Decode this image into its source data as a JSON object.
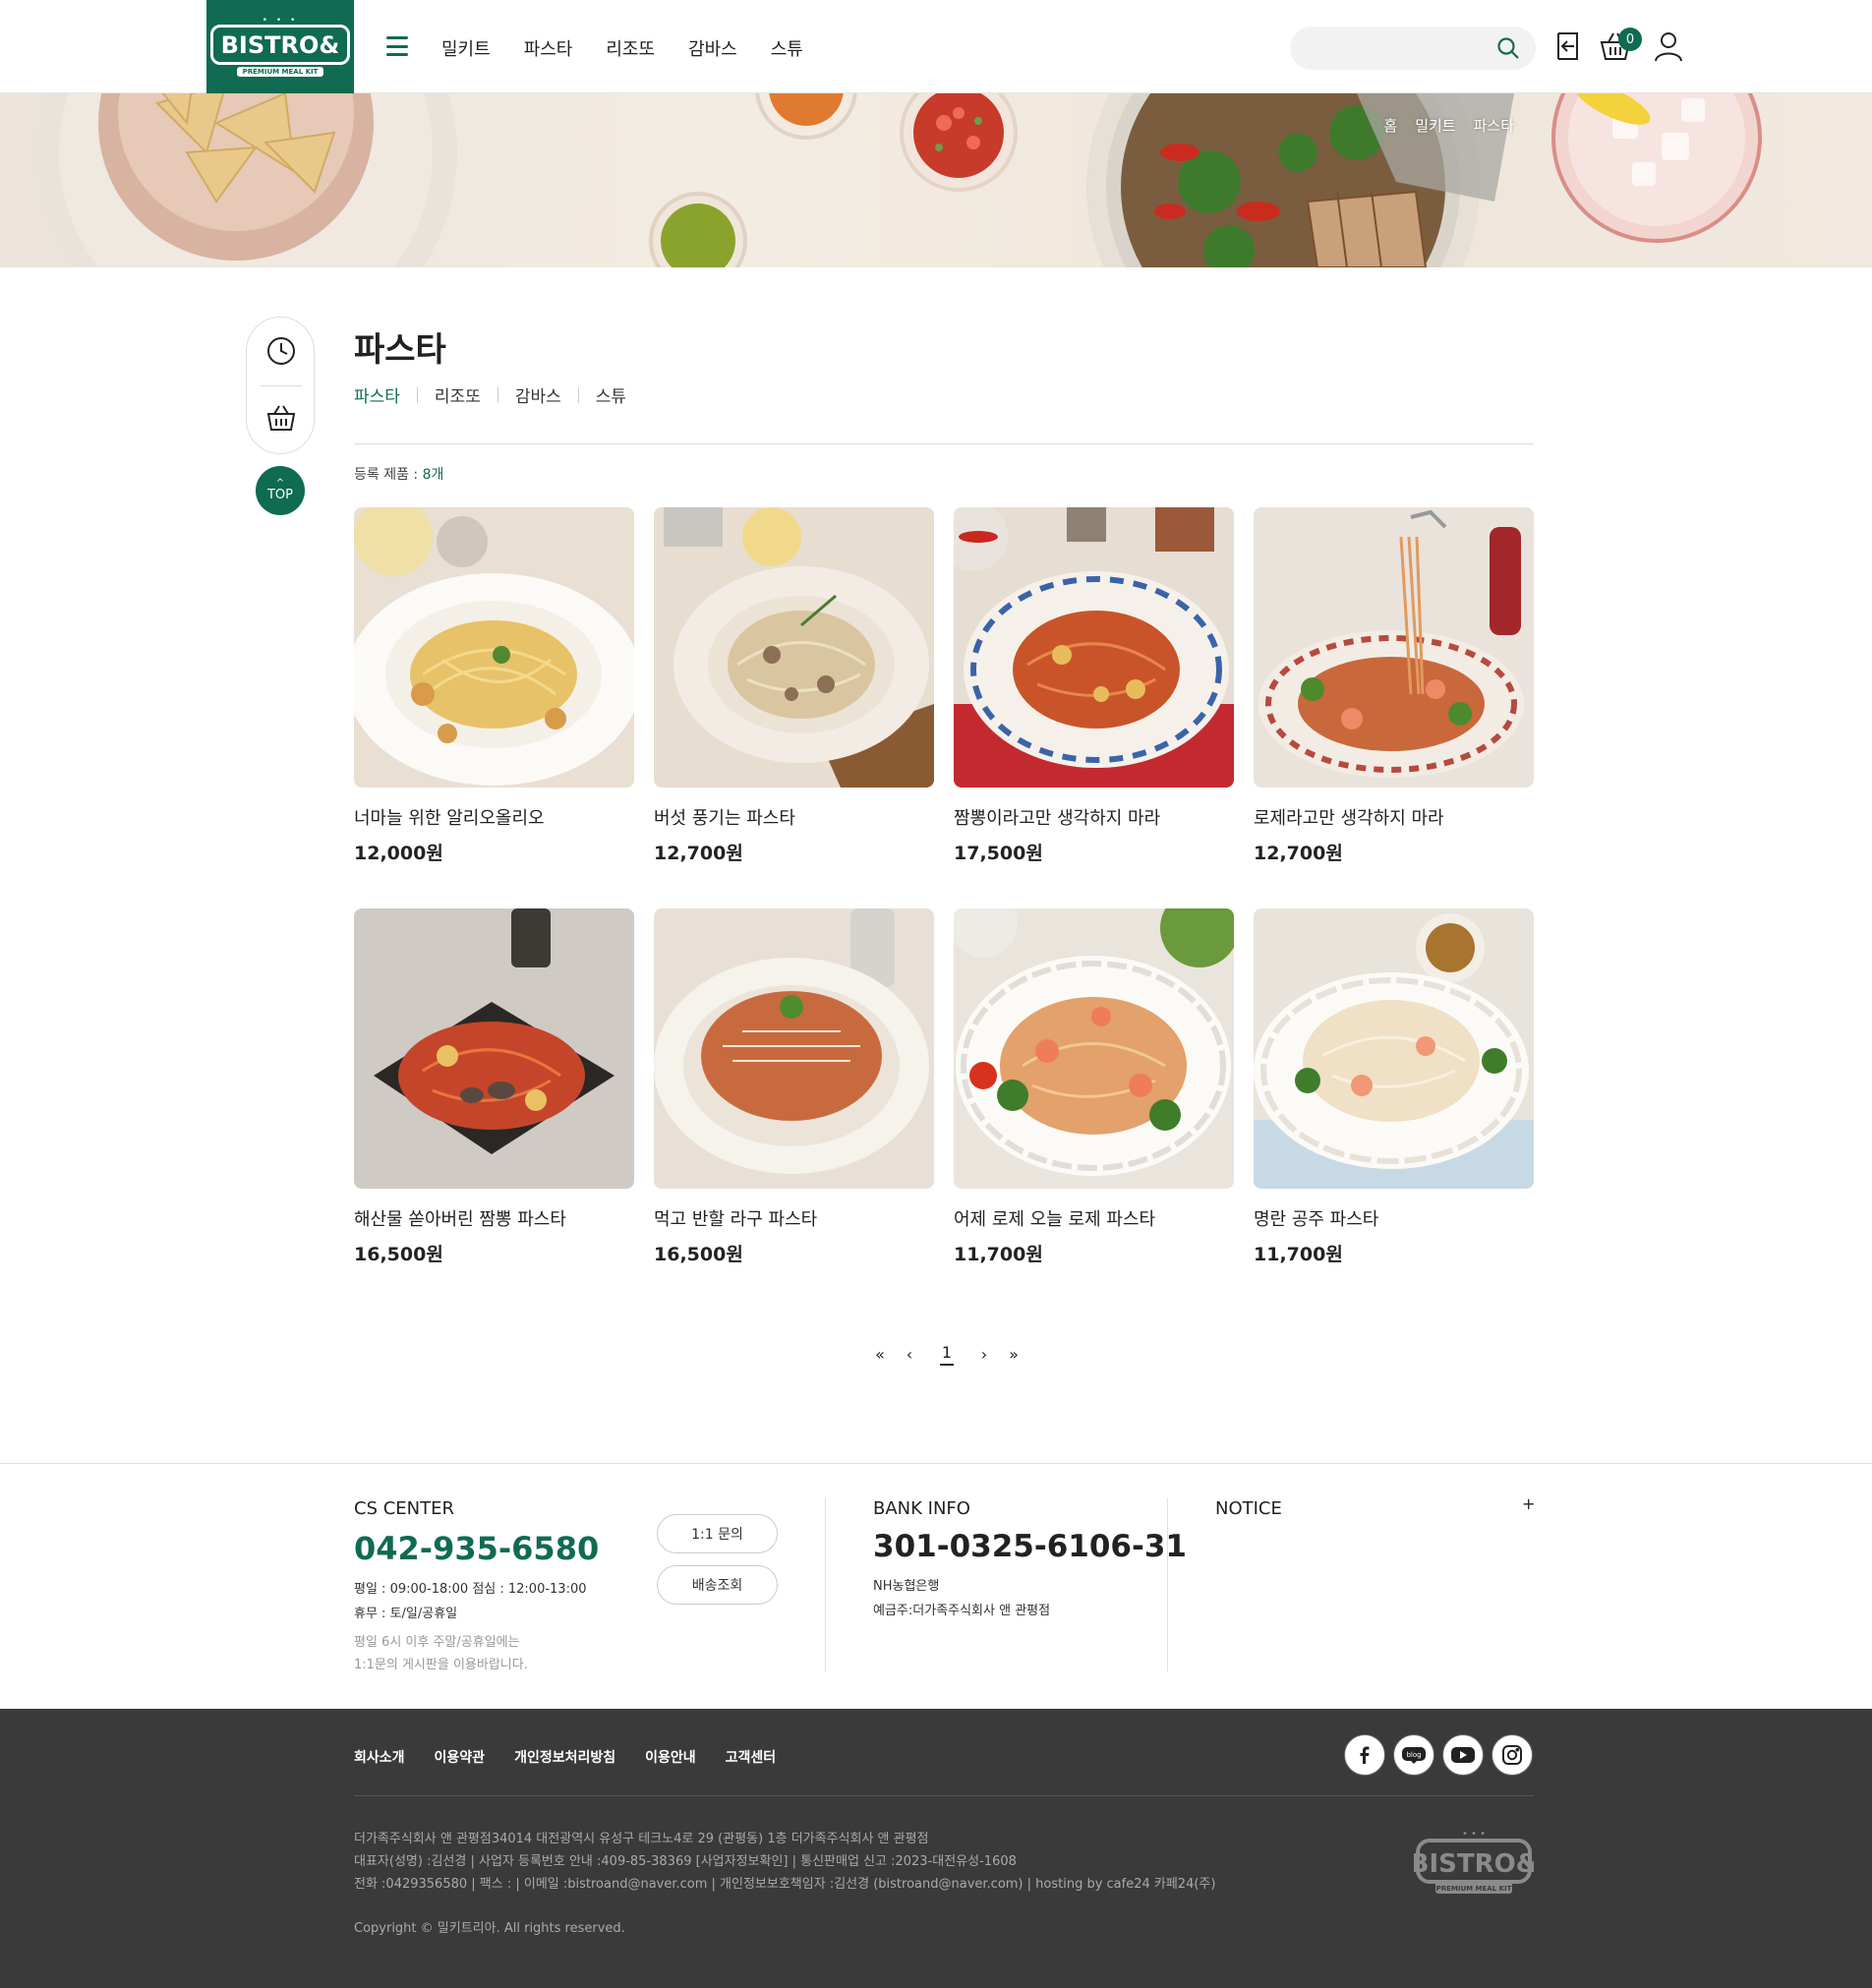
{
  "brand": {
    "logo_text": "BISTRO&",
    "logo_sub": "PREMIUM MEAL KIT"
  },
  "header": {
    "nav": [
      "밀키트",
      "파스타",
      "리조또",
      "감바스",
      "스튜"
    ],
    "search_placeholder": "",
    "cart_count": "0"
  },
  "breadcrumb": [
    "홈",
    "밀키트",
    "파스타"
  ],
  "category": {
    "title": "파스타",
    "subcategories": [
      "파스타",
      "리조또",
      "감바스",
      "스튜"
    ],
    "active_subcategory": "파스타",
    "count_label": "등록 제품 : ",
    "count_value": "8개"
  },
  "quick": {
    "top_label": "TOP"
  },
  "products": [
    {
      "name": "너마늘 위한 알리오올리오",
      "price": "12,000원"
    },
    {
      "name": "버섯 풍기는 파스타",
      "price": "12,700원"
    },
    {
      "name": "짬뽕이라고만 생각하지 마라",
      "price": "17,500원"
    },
    {
      "name": "로제라고만 생각하지 마라",
      "price": "12,700원"
    },
    {
      "name": "해산물 쏟아버린 짬뽕 파스타",
      "price": "16,500원"
    },
    {
      "name": "먹고 반할 라구 파스타",
      "price": "16,500원"
    },
    {
      "name": "어제 로제 오늘 로제 파스타",
      "price": "11,700원"
    },
    {
      "name": "명란 공주 파스타",
      "price": "11,700원"
    }
  ],
  "pagination": {
    "first": "«",
    "prev": "‹",
    "current": "1",
    "next": "›",
    "last": "»"
  },
  "cs": {
    "title": "CS CENTER",
    "phone": "042-935-6580",
    "hours": "평일 : 09:00-18:00 점심 : 12:00-13:00",
    "holiday": "휴무 : 토/일/공휴일",
    "note1": "평일 6시 이후 주말/공휴일에는",
    "note2": "1:1문의 게시판을 이용바랍니다.",
    "btn_inquiry": "1:1 문의",
    "btn_delivery": "배송조회"
  },
  "bank": {
    "title": "BANK INFO",
    "account": "301-0325-6106-31",
    "bank_name": "NH농협은행",
    "holder": "예금주:더가족주식회사 앤 관평점"
  },
  "notice": {
    "title": "NOTICE",
    "more": "+"
  },
  "footer": {
    "links": [
      "회사소개",
      "이용약관",
      "개인정보처리방침",
      "이용안내",
      "고객센터"
    ],
    "info1": "더가족주식회사 앤 관평점34014 대전광역시 유성구 테크노4로 29 (관평동) 1층 더가족주식회사 앤 관평점",
    "info2": "대표자(성명) :김선경 | 사업자 등록번호 안내 :409-85-38369 [사업자정보확인] | 통신판매업 신고 :2023-대전유성-1608",
    "info3": "전화 :0429356580 | 팩스 : | 이메일 :bistroand@naver.com | 개인정보보호책임자 :김선경 (bistroand@naver.com) | hosting by cafe24 카페24(주)",
    "copyright": "Copyright © 밀키트리아. All rights reserved.",
    "social": [
      "facebook-icon",
      "blog-icon",
      "youtube-icon",
      "instagram-icon"
    ],
    "blog_label": "blog"
  },
  "colors": {
    "brand_green": "#0f6b51",
    "footer_dark": "#3a3a3a"
  }
}
